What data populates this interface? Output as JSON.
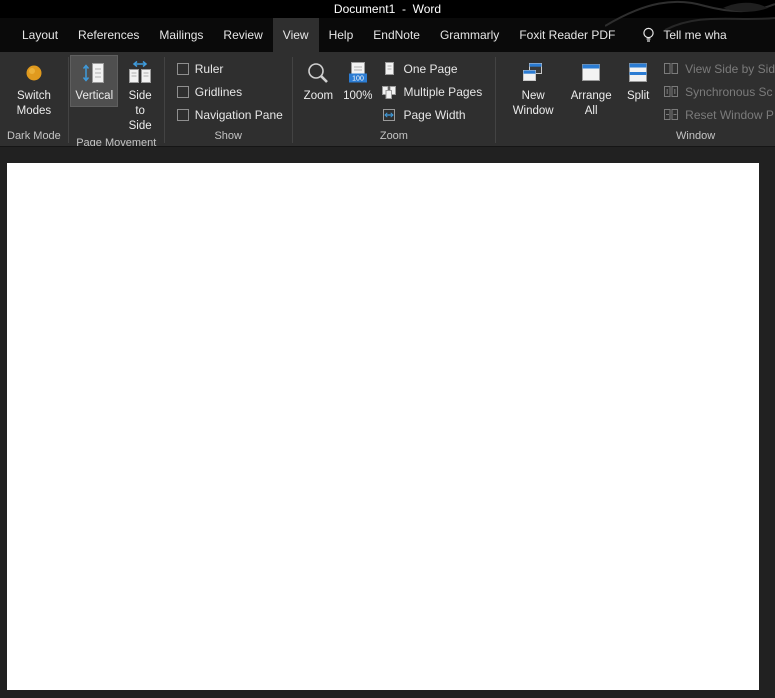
{
  "titlebar": {
    "title": "Document1  -  Word"
  },
  "tab_bar": {
    "items": [
      "Layout",
      "References",
      "Mailings",
      "Review",
      "View",
      "Help",
      "EndNote",
      "Grammarly",
      "Foxit Reader PDF"
    ],
    "active_tab": "View",
    "tell_me": "Tell me wha"
  },
  "ribbon": {
    "dark_mode": {
      "label": "Dark Mode",
      "switch_modes": "Switch Modes"
    },
    "page_movement": {
      "label": "Page Movement",
      "vertical": "Vertical",
      "side_to_side": "Side to Side",
      "selected": "Vertical"
    },
    "show": {
      "label": "Show",
      "ruler": {
        "label": "Ruler",
        "checked": false
      },
      "gridlines": {
        "label": "Gridlines",
        "checked": false
      },
      "navigation_pane": {
        "label": "Navigation Pane",
        "checked": false
      }
    },
    "zoom": {
      "label": "Zoom",
      "zoom": "Zoom",
      "hundred": "100%",
      "hundred_badge": "100",
      "one_page": "One Page",
      "multiple_pages": "Multiple Pages",
      "page_width": "Page Width"
    },
    "window": {
      "label": "Window",
      "new_window": "New Window",
      "arrange_all": "Arrange All",
      "split": "Split",
      "view_side_by_side": "View Side by Sid",
      "synchronous_scrolling": "Synchronous Sc",
      "reset_window_position": "Reset Window P"
    }
  },
  "colors": {
    "titlebar_bg": "#000000",
    "ribbon_bg": "#2f2f2f",
    "accent_blue": "#2b7cd3",
    "arrow_blue": "#3f9bdc",
    "accent_orange": "#e09a1e",
    "text": "#e8e8e8",
    "disabled_text": "#7b7b7b",
    "document_bg": "#ffffff"
  }
}
